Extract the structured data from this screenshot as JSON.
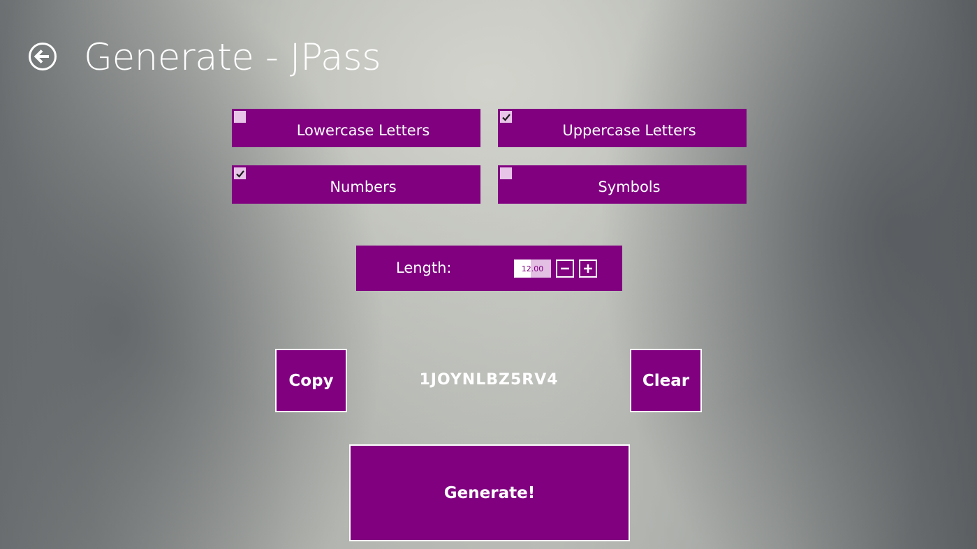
{
  "header": {
    "title": "Generate - JPass",
    "back_icon": "back-arrow-circle-icon"
  },
  "options": [
    {
      "label": "Lowercase Letters",
      "checked": false
    },
    {
      "label": "Uppercase Letters",
      "checked": true
    },
    {
      "label": "Numbers",
      "checked": true
    },
    {
      "label": "Symbols",
      "checked": false
    }
  ],
  "length": {
    "label": "Length:",
    "value": "12.00",
    "decrement_icon": "minus-icon",
    "increment_icon": "plus-icon"
  },
  "result": {
    "password": "1JOYNLBZ5RV4",
    "copy_label": "Copy",
    "clear_label": "Clear"
  },
  "actions": {
    "generate_label": "Generate!"
  },
  "colors": {
    "accent": "#800080",
    "checkbox_fill": "#e8c4e8",
    "text": "#ffffff"
  }
}
